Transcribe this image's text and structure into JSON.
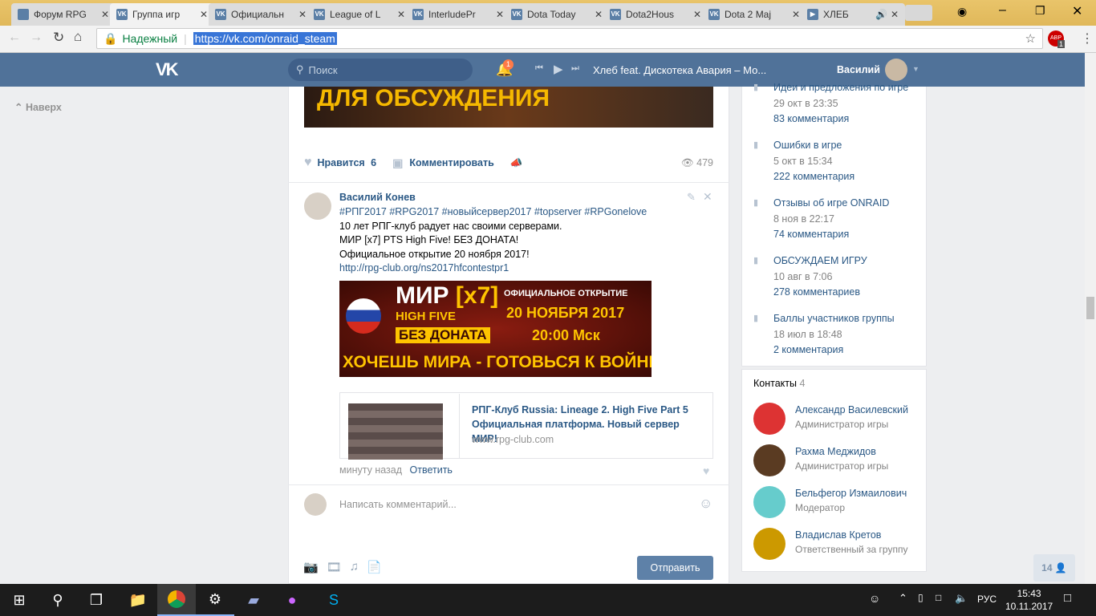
{
  "browser": {
    "tabs": [
      {
        "title": "Форум RPG"
      },
      {
        "title": "Группа игр"
      },
      {
        "title": "Официальн"
      },
      {
        "title": "League of L"
      },
      {
        "title": "InterludePr"
      },
      {
        "title": "Dota Today"
      },
      {
        "title": "Dota2Hous"
      },
      {
        "title": "Dota 2 Maj"
      },
      {
        "title": "ХЛЕБ"
      }
    ],
    "secure_label": "Надежный",
    "url": "https://vk.com/onraid_steam",
    "ext_badge": "1",
    "ext_label": "ABP"
  },
  "vk": {
    "search_placeholder": "Поиск",
    "notif_count": "1",
    "track": "Хлеб feat. Дискотека Авария – Мо...",
    "user": "Василий",
    "back_top": "Наверх",
    "banner_text": "ДЛЯ ОБСУЖДЕНИЯ",
    "prev_post": {
      "like_label": "Нравится",
      "like_count": "6",
      "comment_label": "Комментировать",
      "views": "479"
    },
    "comment": {
      "author": "Василий Конев",
      "lines": [
        "#РПГ2017 #RPG2017 #новыйсервер2017 #topserver #RPGonelove",
        "10 лет РПГ-клуб радует нас своими серверами.",
        "МИР [x7] PTS High Five! БЕЗ ДОНАТА!",
        "Официальное открытие 20 ноября 2017!"
      ],
      "link": "http://rpg-club.org/ns2017hfcontestpr1",
      "image": {
        "l1": "МИР",
        "l1b": "[x7]",
        "l2": "HIGH FIVE",
        "l3": "БЕЗ ДОНАТА",
        "r1": "ОФИЦИАЛЬНОЕ ОТКРЫТИЕ",
        "r2": "20 НОЯБРЯ 2017",
        "r3": "20:00 Мск",
        "bottom": "ХОЧЕШЬ МИРА - ГОТОВЬСЯ К ВОЙНЕ"
      },
      "snippet": {
        "title": "РПГ-Клуб Russia: Lineage 2. High Five Part 5 Официальная платформа. Новый сервер МИР!",
        "domain": "www.rpg-club.com"
      },
      "time": "минуту назад",
      "reply": "Ответить"
    },
    "composer": {
      "placeholder": "Написать комментарий...",
      "send": "Отправить"
    },
    "discussions": [
      {
        "title": "Идеи и предложения по игре",
        "date": "29 окт в 23:35",
        "count": "83 комментария"
      },
      {
        "title": "Ошибки в игре",
        "date": "5 окт в 15:34",
        "count": "222 комментария"
      },
      {
        "title": "Отзывы об игре ONRAID",
        "date": "8 ноя в 22:17",
        "count": "74 комментария"
      },
      {
        "title": "ОБСУЖДАЕМ ИГРУ",
        "date": "10 авг в 7:06",
        "count": "278 комментариев"
      },
      {
        "title": "Баллы участников группы",
        "date": "18 июл в 18:48",
        "count": "2 комментария"
      }
    ],
    "contacts": {
      "label": "Контакты",
      "count": "4",
      "items": [
        {
          "name": "Александр Василевский",
          "role": "Администратор игры",
          "color": "#d33"
        },
        {
          "name": "Рахма Меджидов",
          "role": "Администратор игры",
          "color": "#5a3b22"
        },
        {
          "name": "Бельфегор Измаилович",
          "role": "Модератор",
          "color": "#6cc"
        },
        {
          "name": "Владислав Кретов",
          "role": "Ответственный за группу",
          "color": "#c90"
        }
      ]
    },
    "friends_online": "14"
  },
  "taskbar": {
    "lang": "РУС",
    "time": "15:43",
    "date": "10.11.2017"
  }
}
